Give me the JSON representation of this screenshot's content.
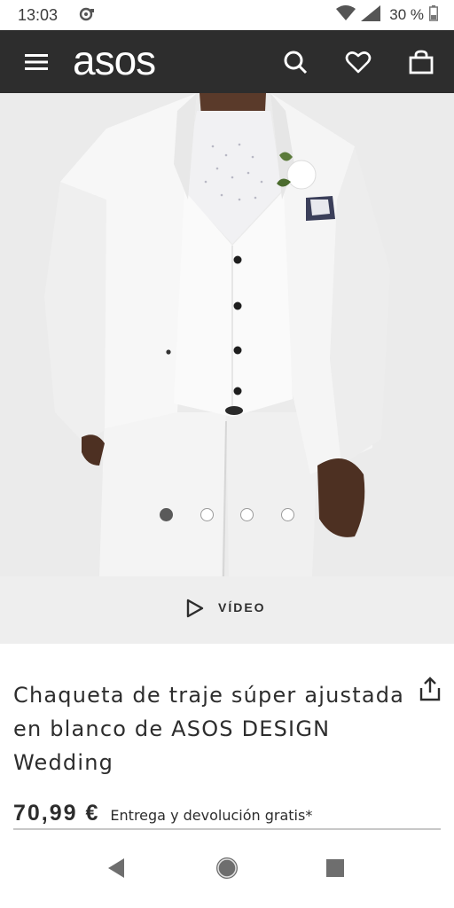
{
  "status_bar": {
    "time": "13:03",
    "battery": "30 %",
    "icons": [
      "notification-icon",
      "wifi-icon",
      "signal-icon",
      "battery-icon"
    ]
  },
  "app_bar": {
    "logo": "asos",
    "icons": [
      "menu-icon",
      "search-icon",
      "heart-icon",
      "bag-icon"
    ]
  },
  "gallery": {
    "image": "product-photo",
    "dots_count": 4,
    "active_index": 0
  },
  "video": {
    "label": "VÍDEO",
    "icon": "play-icon"
  },
  "product": {
    "title": "Chaqueta de traje súper ajustada en blanco de ASOS DESIGN Wedding",
    "price": "70,99 €",
    "delivery": "Entrega y devolución gratis*",
    "share_icon": "share-icon"
  },
  "nav_bar": {
    "icons": [
      "back-icon",
      "home-icon",
      "recents-icon"
    ]
  },
  "colors": {
    "header_bg": "#2d2d2d",
    "text": "#2d2d2d",
    "video_bg": "#eeeeee"
  }
}
